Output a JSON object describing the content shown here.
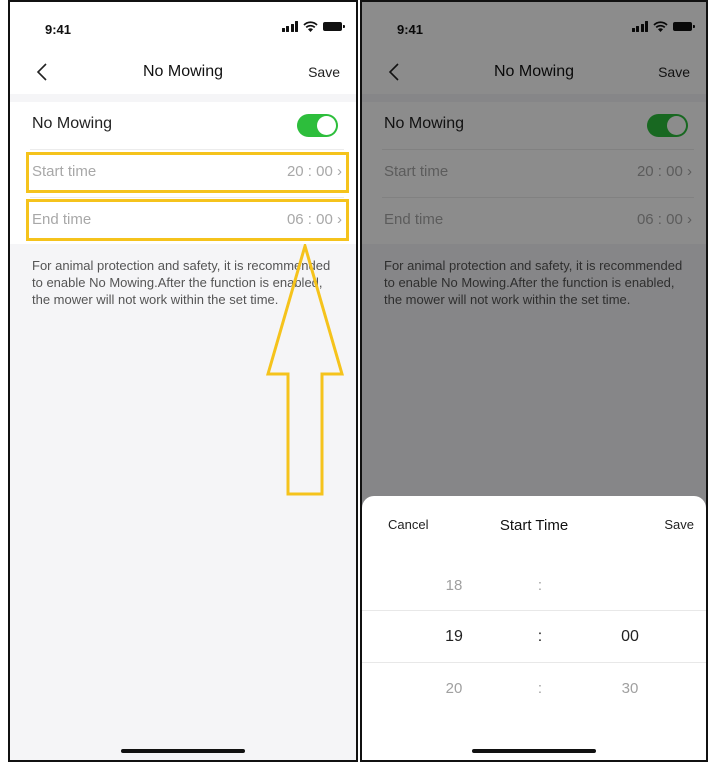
{
  "status": {
    "time": "9:41"
  },
  "nav": {
    "title": "No Mowing",
    "save_label": "Save"
  },
  "settings": {
    "toggle_label": "No Mowing",
    "toggle_on": true,
    "start_label": "Start time",
    "start_value": "20 : 00",
    "end_label": "End time",
    "end_value": "06 : 00",
    "chevron": "›",
    "hint": "For animal protection and safety, it is recommended to enable No Mowing.After the function is enabled, the mower will not work within the set time."
  },
  "picker": {
    "cancel_label": "Cancel",
    "title": "Start Time",
    "save_label": "Save",
    "separator": ":",
    "hours": [
      "18",
      "19",
      "20"
    ],
    "minutes": [
      "00",
      "30"
    ]
  },
  "colors": {
    "toggle_on": "#2dbe3c",
    "highlight": "#f5c31c"
  },
  "icons": [
    "back-chevron-icon",
    "signal-icon",
    "wifi-icon",
    "battery-icon",
    "chevron-right-icon",
    "arrow-up-annotation"
  ]
}
